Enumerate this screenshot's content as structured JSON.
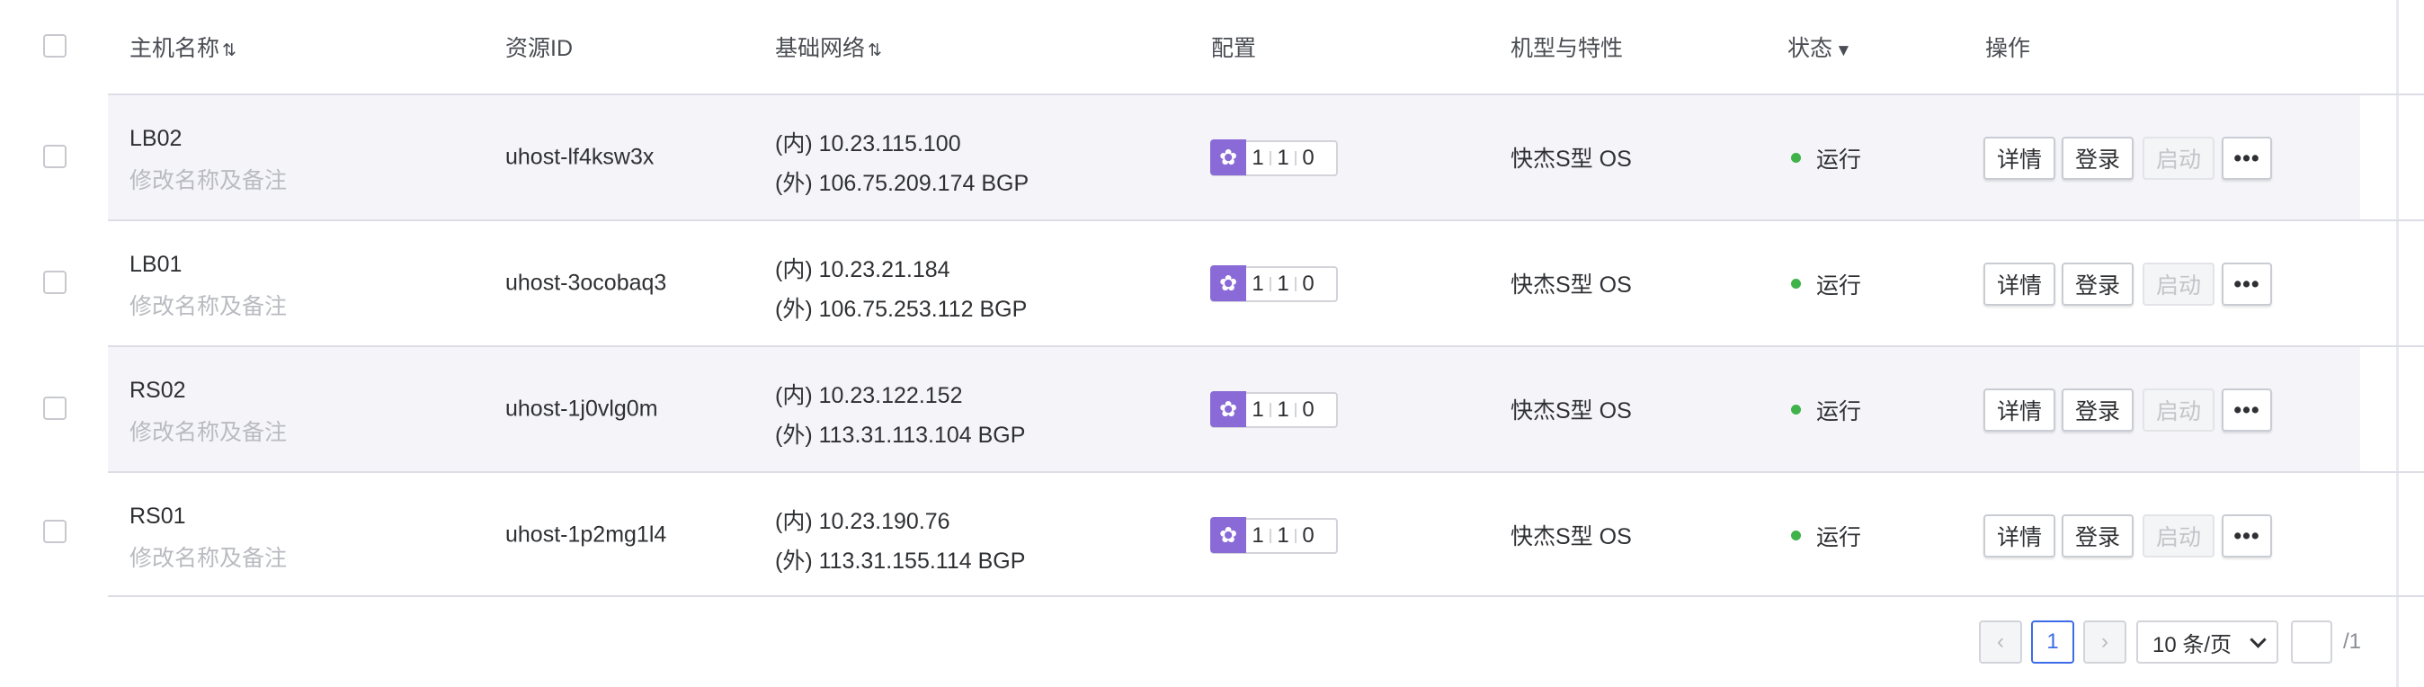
{
  "table": {
    "columns": {
      "name": "主机名称",
      "resource_id": "资源ID",
      "network": "基础网络",
      "config": "配置",
      "machine": "机型与特性",
      "status": "状态",
      "actions": "操作"
    },
    "sort_glyph": "⇅",
    "filter_glyph": "▼",
    "rows": [
      {
        "name": "LB02",
        "remark": "修改名称及备注",
        "resource_id": "uhost-lf4ksw3x",
        "inner_ip": "(内) 10.23.115.100",
        "outer_ip": "(外) 106.75.209.174 BGP",
        "config": [
          "1",
          "1",
          "0"
        ],
        "machine": "快杰S型 OS",
        "status": "运行"
      },
      {
        "name": "LB01",
        "remark": "修改名称及备注",
        "resource_id": "uhost-3ocobaq3",
        "inner_ip": "(内) 10.23.21.184",
        "outer_ip": "(外) 106.75.253.112 BGP",
        "config": [
          "1",
          "1",
          "0"
        ],
        "machine": "快杰S型 OS",
        "status": "运行"
      },
      {
        "name": "RS02",
        "remark": "修改名称及备注",
        "resource_id": "uhost-1j0vlg0m",
        "inner_ip": "(内) 10.23.122.152",
        "outer_ip": "(外) 113.31.113.104 BGP",
        "config": [
          "1",
          "1",
          "0"
        ],
        "machine": "快杰S型 OS",
        "status": "运行"
      },
      {
        "name": "RS01",
        "remark": "修改名称及备注",
        "resource_id": "uhost-1p2mg1l4",
        "inner_ip": "(内) 10.23.190.76",
        "outer_ip": "(外) 113.31.155.114 BGP",
        "config": [
          "1",
          "1",
          "0"
        ],
        "machine": "快杰S型 OS",
        "status": "运行"
      }
    ]
  },
  "row_actions": {
    "detail": "详情",
    "login": "登录",
    "start": "启动",
    "more": "•••"
  },
  "config_icon": "gear-icon",
  "status_color": "#3fb24a",
  "accent_color": "#3d6ce8",
  "config_icon_color": "#8a6ad6",
  "pagination": {
    "prev": "‹",
    "current_page": "1",
    "next": "›",
    "page_size": "10 条/页",
    "jump_value": "",
    "total": "/1"
  }
}
